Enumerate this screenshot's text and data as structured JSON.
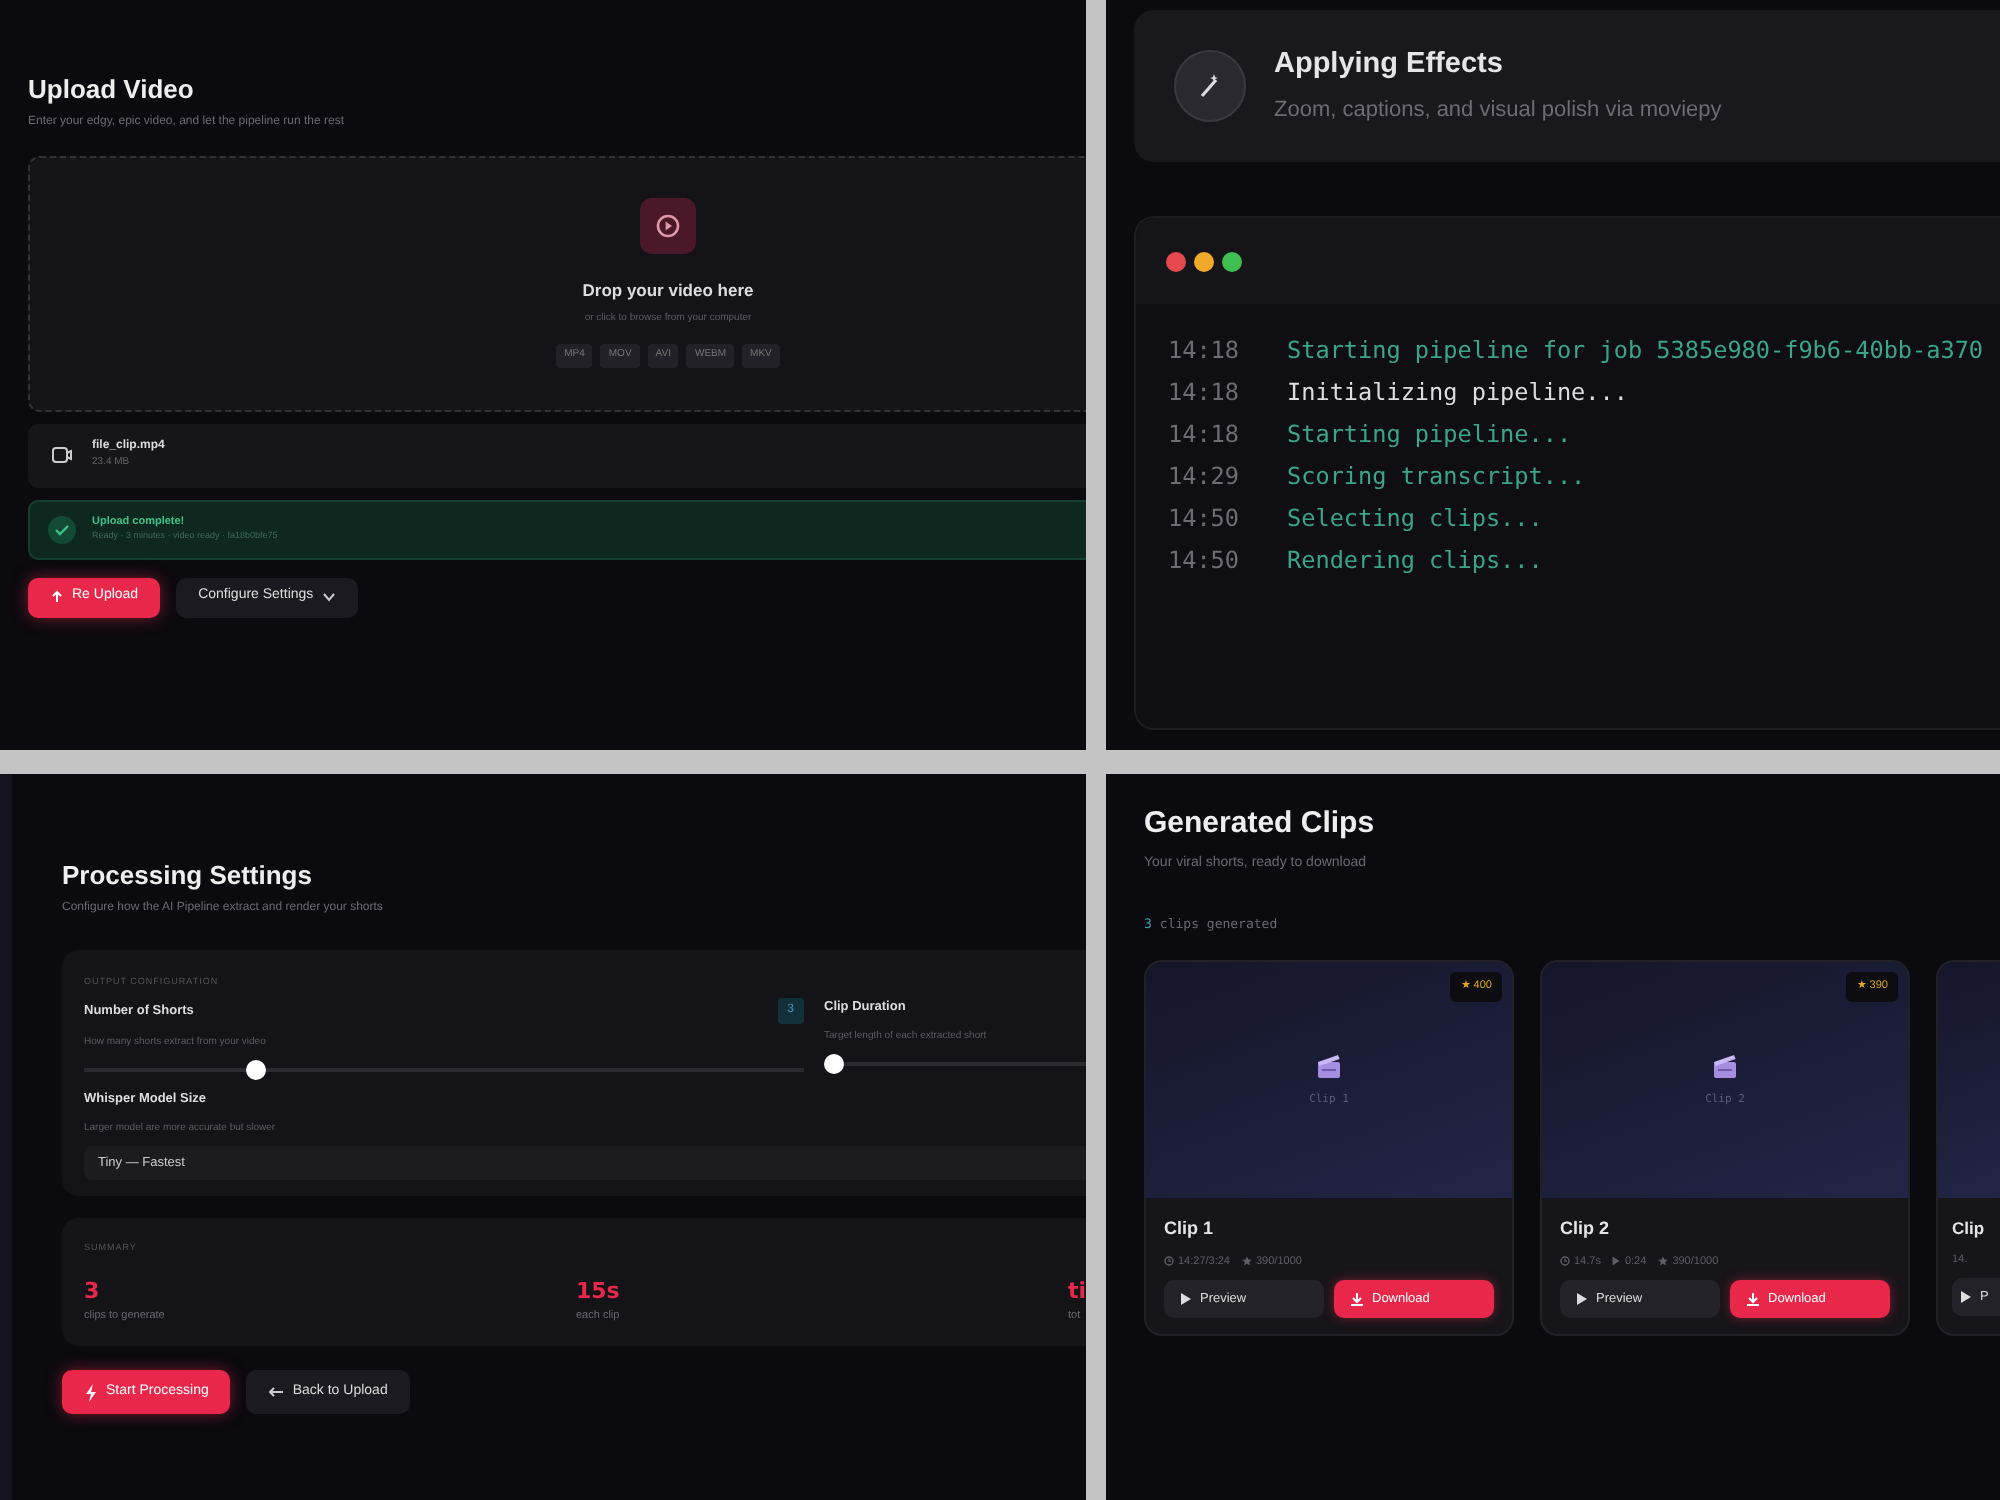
{
  "upload": {
    "title": "Upload Video",
    "subtitle": "Enter your edgy, epic video, and let the pipeline run the rest",
    "dropzone": {
      "title": "Drop your video here",
      "hint": "or click to browse from your computer",
      "formats": [
        "MP4",
        "MOV",
        "AVI",
        "WEBM",
        "MKV"
      ]
    },
    "file": {
      "name": "file_clip.mp4",
      "size": "23.4 MB"
    },
    "status": {
      "title": "Upload complete!",
      "detail": "Ready · 3 minutes · video ready · fa18b0bfe75"
    },
    "buttons": [
      {
        "label": "Re Upload",
        "kind": "primary"
      },
      {
        "label": "Configure Settings",
        "kind": "dropdown"
      }
    ]
  },
  "progress": {
    "step": {
      "title": "Applying Effects",
      "subtitle": "Zoom, captions, and visual polish via moviepy"
    },
    "log": [
      {
        "time": "14:18",
        "message": "Starting pipeline for job 5385e980-f9b6-40bb-a370",
        "kind": "info"
      },
      {
        "time": "14:18",
        "message": "Initializing pipeline...",
        "kind": "plain"
      },
      {
        "time": "14:18",
        "message": "Starting pipeline...",
        "kind": "info"
      },
      {
        "time": "14:29",
        "message": "Scoring transcript...",
        "kind": "info"
      },
      {
        "time": "14:50",
        "message": "Selecting clips...",
        "kind": "info"
      },
      {
        "time": "14:50",
        "message": "Rendering clips...",
        "kind": "info"
      }
    ]
  },
  "settings": {
    "title": "Processing Settings",
    "subtitle": "Configure how the AI Pipeline extract and render your shorts",
    "section_label": "OUTPUT CONFIGURATION",
    "sliders": [
      {
        "label": "Number of Shorts",
        "value": "3",
        "hint": "How many shorts extract from your video",
        "level": 0.23
      },
      {
        "label": "Clip Duration",
        "hint": "Target length of each extracted short",
        "level": 0
      }
    ],
    "model": {
      "label": "Whisper Model Size",
      "hint": "Larger model are more accurate but slower",
      "value": "Tiny — Fastest"
    },
    "summary": {
      "label": "SUMMARY",
      "stats": [
        {
          "value": "3",
          "label": "clips to generate"
        },
        {
          "value": "15s",
          "label": "each clip"
        },
        {
          "value": "ti",
          "label": "tot"
        }
      ]
    },
    "buttons": [
      {
        "label": "Start Processing",
        "kind": "primary"
      },
      {
        "label": "Back to Upload",
        "kind": "back"
      }
    ]
  },
  "clips": {
    "title": "Generated Clips",
    "subtitle": "Your viral shorts, ready to download",
    "count": "3",
    "count_label": "clips generated",
    "items": [
      {
        "score": "★ 400",
        "thumb_label": "Clip 1",
        "title": "Clip 1",
        "duration": "14:27/3:24",
        "rating": "390/1000",
        "buttons": [
          "Preview",
          "Download"
        ]
      },
      {
        "score": "★ 390",
        "thumb_label": "Clip 2",
        "title": "Clip 2",
        "duration": "14.7s",
        "length": "0:24",
        "rating": "390/1000",
        "buttons": [
          "Preview",
          "Download"
        ]
      },
      {
        "title": "Clip",
        "duration": "14.",
        "buttons": [
          "P"
        ]
      }
    ]
  }
}
